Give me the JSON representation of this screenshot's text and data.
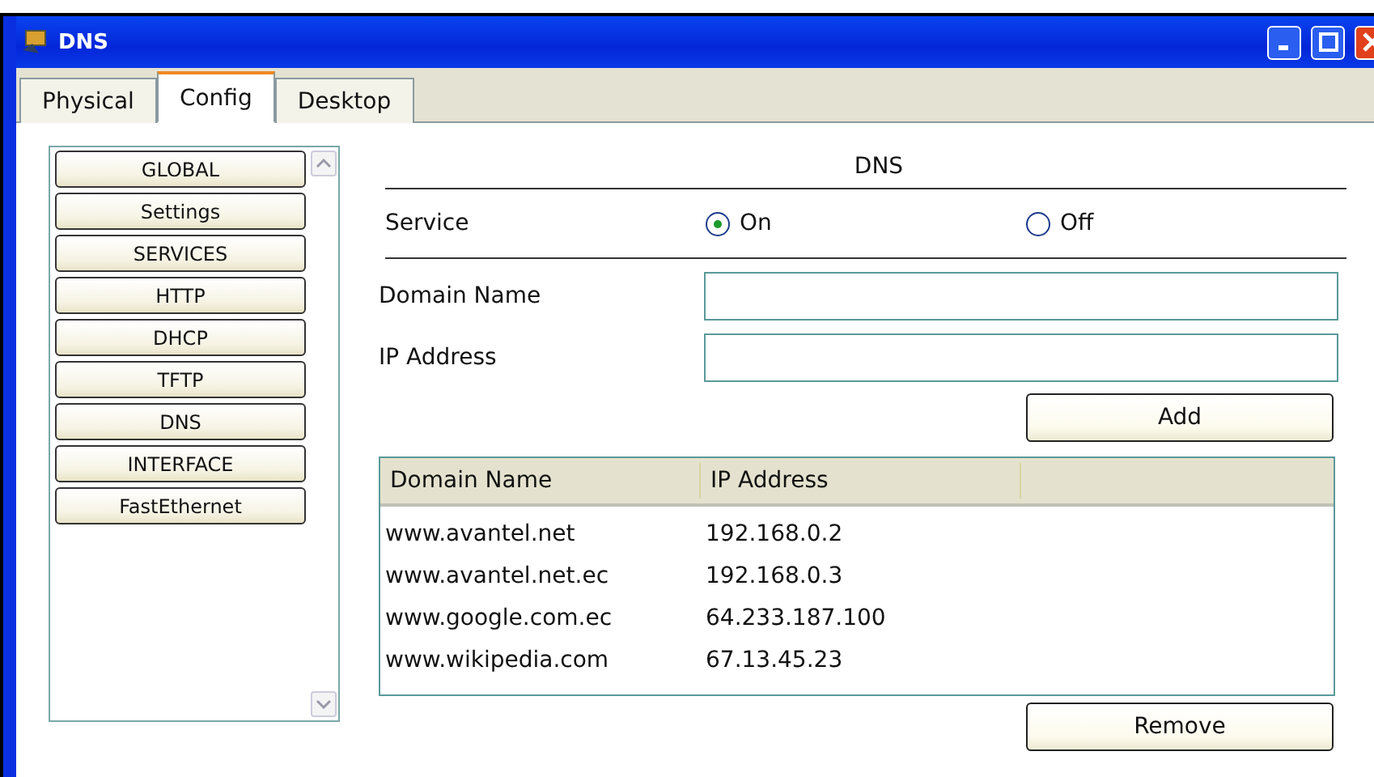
{
  "window": {
    "title": "DNS"
  },
  "tabs": [
    {
      "label": "Physical",
      "selected": false
    },
    {
      "label": "Config",
      "selected": true
    },
    {
      "label": "Desktop",
      "selected": false
    }
  ],
  "sidebar": {
    "items": [
      "GLOBAL",
      "Settings",
      "SERVICES",
      "HTTP",
      "DHCP",
      "TFTP",
      "DNS",
      "INTERFACE",
      "FastEthernet"
    ]
  },
  "panel": {
    "title": "DNS",
    "service": {
      "label": "Service",
      "options": [
        {
          "label": "On",
          "selected": true
        },
        {
          "label": "Off",
          "selected": false
        }
      ]
    },
    "fields": [
      {
        "label": "Domain Name"
      },
      {
        "label": "IP Address"
      }
    ],
    "add_button": "Add",
    "table": {
      "columns": [
        "Domain Name",
        "IP Address"
      ],
      "rows": [
        [
          "www.avantel.net",
          "192.168.0.2"
        ],
        [
          "www.avantel.net.ec",
          "192.168.0.3"
        ],
        [
          "www.google.com.ec",
          "64.233.187.100"
        ],
        [
          "www.wikipedia.com",
          "67.13.45.23"
        ]
      ]
    },
    "remove_button": "Remove"
  }
}
